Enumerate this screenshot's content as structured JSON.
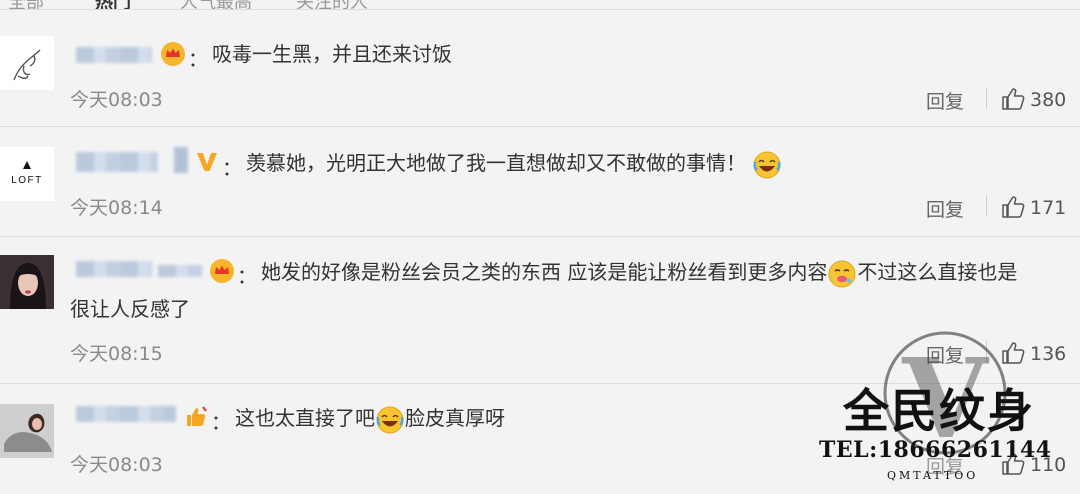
{
  "tabs": [
    {
      "label": "全部",
      "active": false
    },
    {
      "label": "热门",
      "active": true
    },
    {
      "label": "人气最高",
      "active": false
    },
    {
      "label": "关注的人",
      "active": false
    }
  ],
  "comments": [
    {
      "colon": "：",
      "text": "吸毒一生黑，并且还来讨饭",
      "time": "今天08:03",
      "reply": "回复",
      "likes": "380",
      "badge": "crown-icon"
    },
    {
      "colon": "：",
      "text": "羡慕她，光明正大地做了我一直想做却又不敢做的事情！",
      "time": "今天08:14",
      "reply": "回复",
      "likes": "171",
      "badge": "v-icon"
    },
    {
      "colon": "：",
      "text_part1": "她发的好像是粉丝会员之类的东西 应该是能让粉丝看到更多内容",
      "text_part2": "不过这么直接也是",
      "text_line2": "很让人反感了",
      "time": "今天08:15",
      "reply": "回复",
      "likes": "136",
      "badge": "crown-icon"
    },
    {
      "colon": "：",
      "text_part1": "这也太直接了吧",
      "text_part2": "脸皮真厚呀",
      "time": "今天08:03",
      "reply": "回复",
      "likes": "110",
      "badge": "thumb-badge-icon"
    }
  ],
  "avatar2_text": "LOFT",
  "watermark": {
    "title": "全民纹身",
    "phone": "TEL:18666261144",
    "brand": "QMTATTOO",
    "letter": "V"
  },
  "colors": {
    "background": "#f3f3f3",
    "text": "#333333",
    "meta": "#8a8a8a",
    "gold": "#f5a623",
    "crown_red": "#e6362a"
  }
}
